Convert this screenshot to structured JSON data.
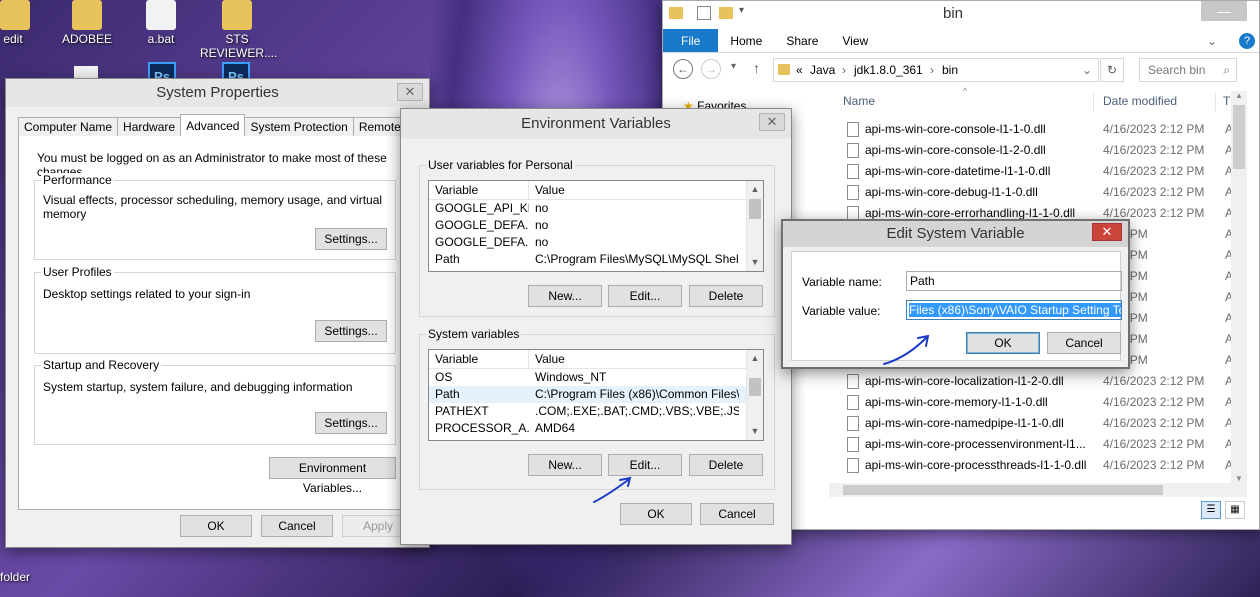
{
  "desktop": {
    "icons": [
      {
        "label": "edit"
      },
      {
        "label": "ADOBEE"
      },
      {
        "label": "a.bat"
      },
      {
        "label": "STS REVIEWER...."
      },
      {
        "label": "folder"
      }
    ]
  },
  "system_properties": {
    "title": "System Properties",
    "tabs": [
      "Computer Name",
      "Hardware",
      "Advanced",
      "System Protection",
      "Remote"
    ],
    "admin_note": "You must be logged on as an Administrator to make most of these changes.",
    "performance": {
      "title": "Performance",
      "desc": "Visual effects, processor scheduling, memory usage, and virtual memory",
      "button": "Settings..."
    },
    "user_profiles": {
      "title": "User Profiles",
      "desc": "Desktop settings related to your sign-in",
      "button": "Settings..."
    },
    "startup": {
      "title": "Startup and Recovery",
      "desc": "System startup, system failure, and debugging information",
      "button": "Settings..."
    },
    "env_button": "Environment Variables...",
    "ok": "OK",
    "cancel": "Cancel",
    "apply": "Apply"
  },
  "env_vars": {
    "title": "Environment Variables",
    "user_group": "User variables for Personal",
    "system_group": "System variables",
    "col_variable": "Variable",
    "col_value": "Value",
    "user_rows": [
      {
        "name": "GOOGLE_API_KEY",
        "value": "no"
      },
      {
        "name": "GOOGLE_DEFA...",
        "value": "no"
      },
      {
        "name": "GOOGLE_DEFA...",
        "value": "no"
      },
      {
        "name": "Path",
        "value": "C:\\Program Files\\MySQL\\MySQL Shell 8...."
      }
    ],
    "system_rows": [
      {
        "name": "OS",
        "value": "Windows_NT"
      },
      {
        "name": "Path",
        "value": "C:\\Program Files (x86)\\Common Files\\O..."
      },
      {
        "name": "PATHEXT",
        "value": ".COM;.EXE;.BAT;.CMD;.VBS;.VBE;.JS;...."
      },
      {
        "name": "PROCESSOR_A...",
        "value": "AMD64"
      }
    ],
    "new": "New...",
    "edit": "Edit...",
    "delete": "Delete",
    "ok": "OK",
    "cancel": "Cancel"
  },
  "edit_var": {
    "title": "Edit System Variable",
    "name_label": "Variable name:",
    "name_value": "Path",
    "value_label": "Variable value:",
    "value_value": "Files (x86)\\Sony\\VAIO Startup Setting Tool",
    "ok": "OK",
    "cancel": "Cancel"
  },
  "explorer": {
    "title": "bin",
    "ribbon": [
      "File",
      "Home",
      "Share",
      "View"
    ],
    "breadcrumb": [
      "«",
      "Java",
      "jdk1.8.0_361",
      "bin"
    ],
    "search_placeholder": "Search bin",
    "nav_favorites": "Favorites",
    "col_name": "Name",
    "col_date": "Date modified",
    "col_type": "T",
    "files": [
      {
        "name": "api-ms-win-core-console-l1-1-0.dll",
        "date": "4/16/2023 2:12 PM",
        "type": "A"
      },
      {
        "name": "api-ms-win-core-console-l1-2-0.dll",
        "date": "4/16/2023 2:12 PM",
        "type": "A"
      },
      {
        "name": "api-ms-win-core-datetime-l1-1-0.dll",
        "date": "4/16/2023 2:12 PM",
        "type": "A"
      },
      {
        "name": "api-ms-win-core-debug-l1-1-0.dll",
        "date": "4/16/2023 2:12 PM",
        "type": "A"
      },
      {
        "name": "api-ms-win-core-errorhandling-l1-1-0.dll",
        "date": "4/16/2023 2:12 PM",
        "type": "A"
      },
      {
        "name": "",
        "date": "2:12 PM",
        "type": "A"
      },
      {
        "name": "",
        "date": "2:12 PM",
        "type": "A"
      },
      {
        "name": "",
        "date": "2:12 PM",
        "type": "A"
      },
      {
        "name": "",
        "date": "2:12 PM",
        "type": "A"
      },
      {
        "name": "",
        "date": "2:12 PM",
        "type": "A"
      },
      {
        "name": "",
        "date": "2:12 PM",
        "type": "A"
      },
      {
        "name": "",
        "date": "2:12 PM",
        "type": "A"
      },
      {
        "name": "api-ms-win-core-localization-l1-2-0.dll",
        "date": "4/16/2023 2:12 PM",
        "type": "A"
      },
      {
        "name": "api-ms-win-core-memory-l1-1-0.dll",
        "date": "4/16/2023 2:12 PM",
        "type": "A"
      },
      {
        "name": "api-ms-win-core-namedpipe-l1-1-0.dll",
        "date": "4/16/2023 2:12 PM",
        "type": "A"
      },
      {
        "name": "api-ms-win-core-processenvironment-l1...",
        "date": "4/16/2023 2:12 PM",
        "type": "A"
      },
      {
        "name": "api-ms-win-core-processthreads-l1-1-0.dll",
        "date": "4/16/2023 2:12 PM",
        "type": "A"
      }
    ]
  }
}
